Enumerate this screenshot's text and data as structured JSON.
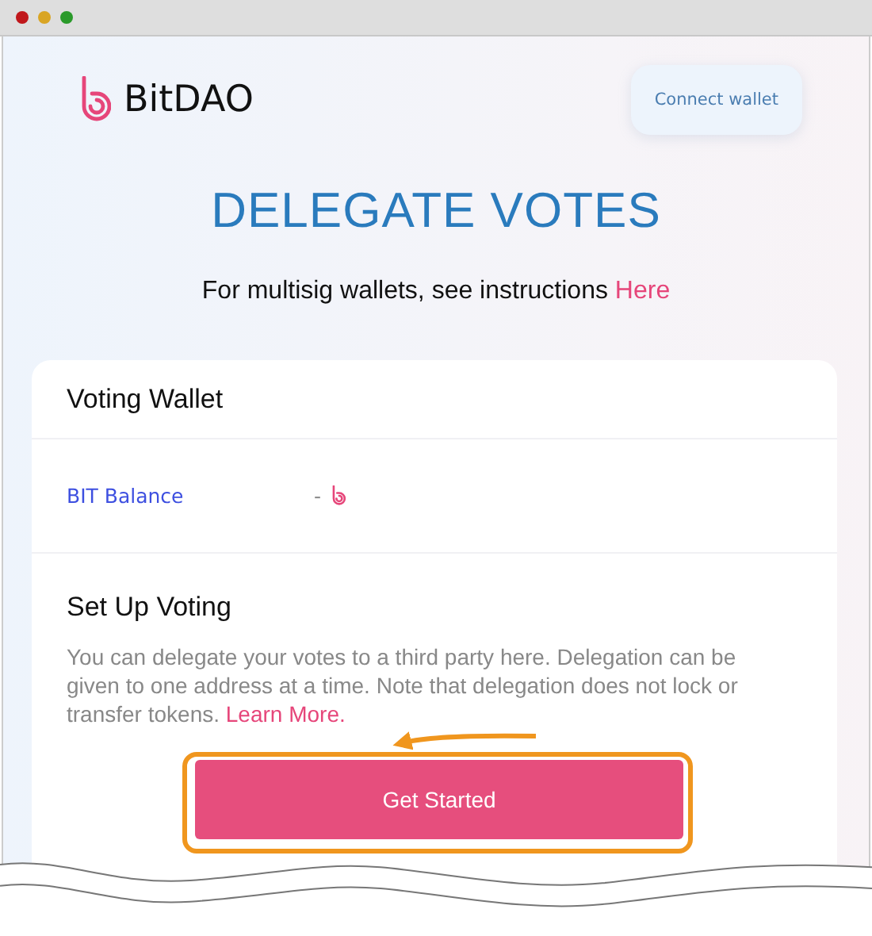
{
  "header": {
    "brand": "BitDAO",
    "connect_button": "Connect wallet"
  },
  "title": "DELEGATE VOTES",
  "subtitle": {
    "text": "For multisig wallets, see instructions ",
    "link": "Here"
  },
  "card": {
    "heading": "Voting Wallet",
    "balance": {
      "label": "BIT Balance",
      "value": "-"
    },
    "setup": {
      "heading": "Set Up Voting",
      "text": "You can delegate your votes to a third party here. Delegation can be given to one address at a time. Note that delegation does not lock or transfer tokens. ",
      "link": "Learn More.",
      "button": "Get Started"
    }
  }
}
